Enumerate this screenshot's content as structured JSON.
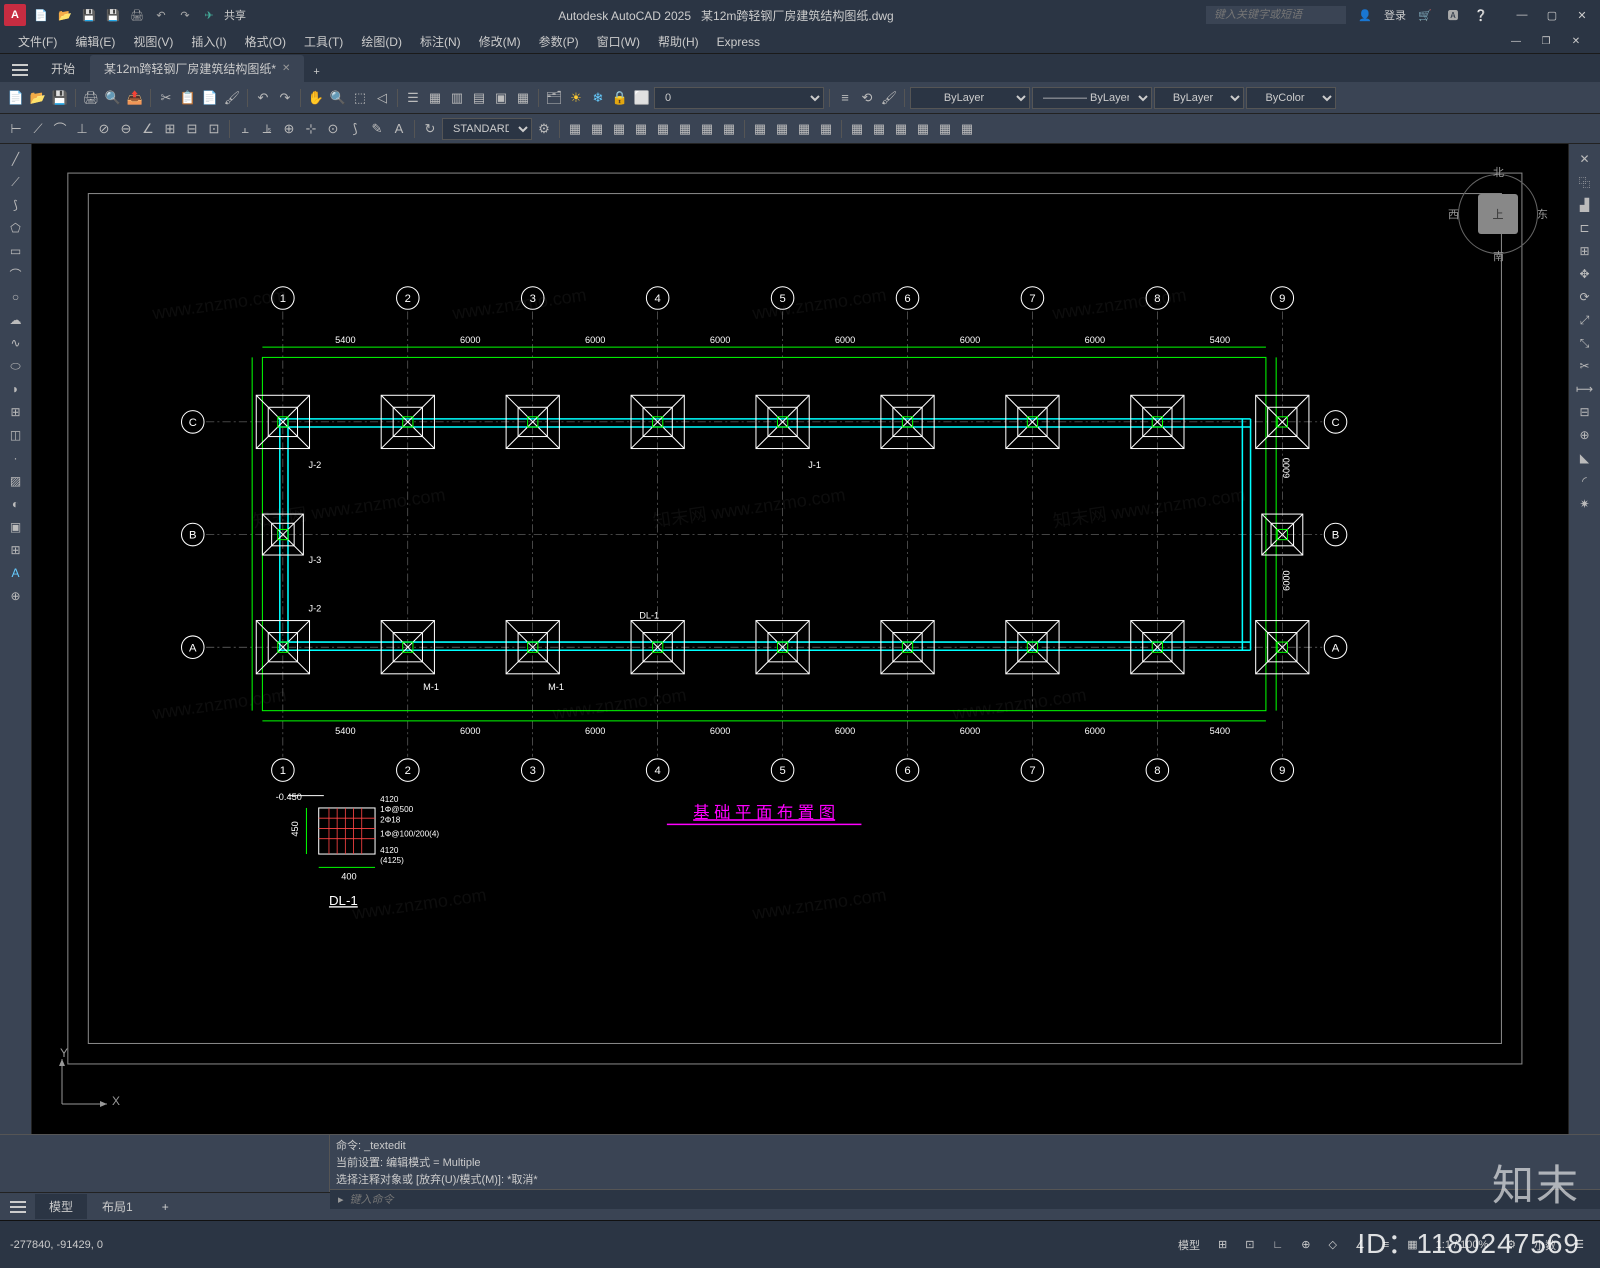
{
  "app": {
    "name": "Autodesk AutoCAD 2025",
    "file": "某12m跨轻钢厂房建筑结构图纸.dwg"
  },
  "titlebar": {
    "share": "共享",
    "search_ph": "键入关键字或短语",
    "login": "登录"
  },
  "menus": [
    "文件(F)",
    "编辑(E)",
    "视图(V)",
    "插入(I)",
    "格式(O)",
    "工具(T)",
    "绘图(D)",
    "标注(N)",
    "修改(M)",
    "参数(P)",
    "窗口(W)",
    "帮助(H)",
    "Express"
  ],
  "tabs": {
    "start": "开始",
    "file": "某12m跨轻钢厂房建筑结构图纸*"
  },
  "layer": {
    "current": "0",
    "linetype": "ByLayer",
    "lineweight": "ByLayer",
    "linetype2": "ByLayer",
    "color": "ByColor"
  },
  "style": "STANDARD",
  "viewcube": {
    "top": "上",
    "n": "北",
    "s": "南",
    "e": "东",
    "w": "西"
  },
  "drawing": {
    "title": "基 础 平 面 布 置 图",
    "detail": "DL-1",
    "grids_x": [
      "1",
      "2",
      "3",
      "4",
      "5",
      "6",
      "7",
      "8",
      "9"
    ],
    "grids_y": [
      "A",
      "B",
      "C"
    ],
    "dims_top": [
      "5400",
      "6000",
      "6000",
      "6000",
      "6000",
      "6000",
      "6000",
      "5400"
    ],
    "dims_left": [
      "6000",
      "6000"
    ],
    "labels": {
      "j1": "J-1",
      "j2": "J-2",
      "j3": "J-3",
      "dl1": "DL-1",
      "m1": "M-1"
    },
    "detail_dims": {
      "w": "400",
      "w2": "(4125)",
      "t1": "4120",
      "t2": "1Φ@500",
      "t3": "2Φ18",
      "t4": "1Φ@100/200(4)",
      "lev": "-0.450",
      "h": "450"
    }
  },
  "cmd": {
    "l1": "命令:  _textedit",
    "l2": "当前设置: 编辑模式 = Multiple",
    "l3": "选择注释对象或 [放弃(U)/模式(M)]:  *取消*",
    "prompt": "▸",
    "ph": "键入命令"
  },
  "layouts": {
    "model": "模型",
    "layout1": "布局1"
  },
  "status": {
    "coords": "-277840, -91429, 0",
    "model": "模型",
    "scale": "1:1 / 100%",
    "dec": "小数"
  },
  "znmo": "知末",
  "id": "ID：1180247569"
}
